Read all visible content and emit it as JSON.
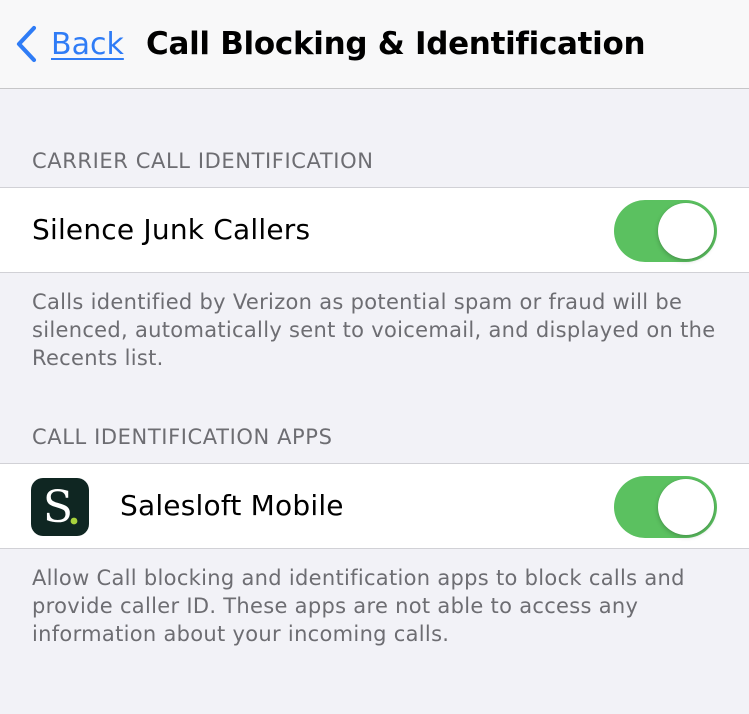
{
  "navbar": {
    "back_label": "Back",
    "title": "Call Blocking & Identification"
  },
  "carrier_section": {
    "header": "CARRIER CALL IDENTIFICATION",
    "row_label": "Silence Junk Callers",
    "toggle_on": true,
    "footer": "Calls identified by Verizon as potential spam or fraud will be silenced, automatically sent to voicemail, and displayed on the Recents list."
  },
  "apps_section": {
    "header": "CALL IDENTIFICATION APPS",
    "app_name": "Salesloft Mobile",
    "app_icon_letter": "S",
    "toggle_on": true,
    "footer": "Allow Call blocking and identification apps to block calls and provide caller ID. These apps are not able to access any information about your incoming calls."
  },
  "colors": {
    "accent": "#2f7cf6",
    "toggle_on": "#5bc160",
    "background": "#f2f2f7",
    "app_icon_bg": "#0f2622",
    "app_icon_dot": "#a8d23c"
  }
}
